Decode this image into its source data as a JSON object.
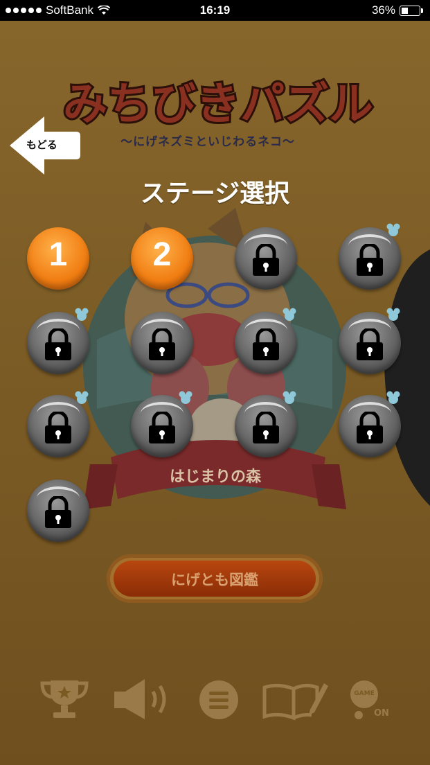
{
  "status_bar": {
    "carrier": "SoftBank",
    "time": "16:19",
    "battery": "36%"
  },
  "header": {
    "logo_text": "みちびきパズル",
    "subtitle": "〜にげネズミといじわるネコ〜",
    "back_label": "もどる"
  },
  "page_title": "ステージ選択",
  "area_label": "はじまりの森",
  "stages": [
    {
      "label": "1",
      "locked": false
    },
    {
      "label": "2",
      "locked": false
    },
    {
      "label": "",
      "locked": true
    },
    {
      "label": "",
      "locked": true
    },
    {
      "label": "",
      "locked": true
    },
    {
      "label": "",
      "locked": true
    },
    {
      "label": "",
      "locked": true
    },
    {
      "label": "",
      "locked": true
    },
    {
      "label": "",
      "locked": true
    },
    {
      "label": "",
      "locked": true
    },
    {
      "label": "",
      "locked": true
    },
    {
      "label": "",
      "locked": true
    },
    {
      "label": "",
      "locked": true
    }
  ],
  "encyclopedia_button": "にげとも図鑑",
  "toolbar": {
    "items": [
      "trophy-icon",
      "speaker-icon",
      "menu-icon",
      "book-icon",
      "game-center-icon"
    ],
    "game_label": "GAME",
    "game_state": "ON"
  },
  "colors": {
    "background": "#7a5a22",
    "stage_open": "#f07d12",
    "stage_locked": "#5e5e5e",
    "button": "#b8470f"
  }
}
